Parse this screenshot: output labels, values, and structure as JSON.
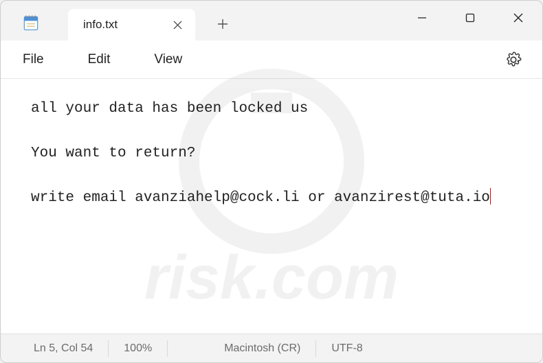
{
  "tab": {
    "title": "info.txt"
  },
  "menu": {
    "file": "File",
    "edit": "Edit",
    "view": "View"
  },
  "content": {
    "line1": "all your data has been locked us",
    "line2": "You want to return?",
    "line3": "write email avanziahelp@cock.li or avanzirest@tuta.io"
  },
  "status": {
    "position": "Ln 5, Col 54",
    "zoom": "100%",
    "line_ending": "Macintosh (CR)",
    "encoding": "UTF-8"
  }
}
